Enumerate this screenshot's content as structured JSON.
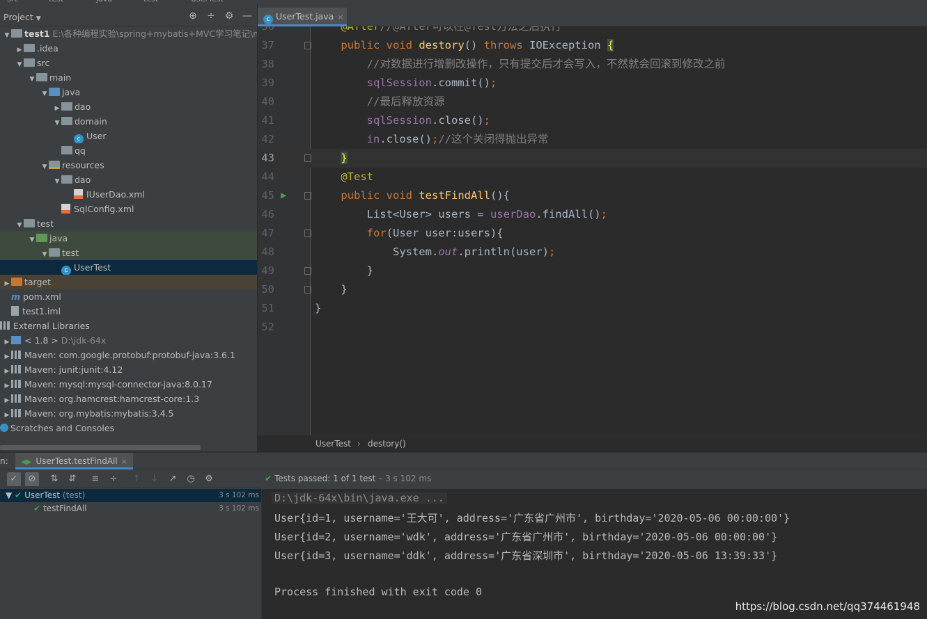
{
  "breadcrumb_top": [
    "src",
    "test",
    "java",
    "test",
    "UserTest"
  ],
  "project_panel": {
    "title": "Project",
    "tree": [
      {
        "label": "test1",
        "extra": "E:\\各种编程实验\\spring+mybatis+MVC学习笔记\\mybatis",
        "depth": 0,
        "arrow": "▼",
        "icon": "folder",
        "bold": true
      },
      {
        "label": ".idea",
        "depth": 1,
        "arrow": "▶",
        "icon": "folder"
      },
      {
        "label": "src",
        "depth": 1,
        "arrow": "▼",
        "icon": "folder"
      },
      {
        "label": "main",
        "depth": 2,
        "arrow": "▼",
        "icon": "folder"
      },
      {
        "label": "java",
        "depth": 3,
        "arrow": "▼",
        "icon": "folder-blue"
      },
      {
        "label": "dao",
        "depth": 4,
        "arrow": "▶",
        "icon": "folder"
      },
      {
        "label": "domain",
        "depth": 4,
        "arrow": "▼",
        "icon": "folder"
      },
      {
        "label": "User",
        "depth": 5,
        "arrow": "",
        "icon": "class"
      },
      {
        "label": "qq",
        "depth": 4,
        "arrow": "",
        "icon": "folder"
      },
      {
        "label": "resources",
        "depth": 3,
        "arrow": "▼",
        "icon": "folder-res"
      },
      {
        "label": "dao",
        "depth": 4,
        "arrow": "▼",
        "icon": "folder"
      },
      {
        "label": "IUserDao.xml",
        "depth": 5,
        "arrow": "",
        "icon": "xml"
      },
      {
        "label": "SqlConfig.xml",
        "depth": 4,
        "arrow": "",
        "icon": "xml"
      },
      {
        "label": "test",
        "depth": 1,
        "arrow": "▼",
        "icon": "folder"
      },
      {
        "label": "java",
        "depth": 2,
        "arrow": "▼",
        "icon": "folder-green",
        "highlight": "green"
      },
      {
        "label": "test",
        "depth": 3,
        "arrow": "▼",
        "icon": "folder",
        "highlight": "green"
      },
      {
        "label": "UserTest",
        "depth": 4,
        "arrow": "",
        "icon": "class",
        "highlight": "selected"
      },
      {
        "label": "target",
        "depth": 0,
        "arrow": "▶",
        "icon": "folder-orange",
        "highlight": "brown"
      },
      {
        "label": "pom.xml",
        "depth": 0,
        "arrow": "",
        "icon": "maven"
      },
      {
        "label": "test1.iml",
        "depth": 0,
        "arrow": "",
        "icon": "file"
      },
      {
        "label": "External Libraries",
        "depth": -1,
        "arrow": "",
        "icon": "lib"
      },
      {
        "label": "< 1.8 >",
        "extra": "D:\\jdk-64x",
        "depth": 0,
        "arrow": "▶",
        "icon": "jdk"
      },
      {
        "label": "Maven: com.google.protobuf:protobuf-java:3.6.1",
        "depth": 0,
        "arrow": "▶",
        "icon": "lib"
      },
      {
        "label": "Maven: junit:junit:4.12",
        "depth": 0,
        "arrow": "▶",
        "icon": "lib"
      },
      {
        "label": "Maven: mysql:mysql-connector-java:8.0.17",
        "depth": 0,
        "arrow": "▶",
        "icon": "lib"
      },
      {
        "label": "Maven: org.hamcrest:hamcrest-core:1.3",
        "depth": 0,
        "arrow": "▶",
        "icon": "lib"
      },
      {
        "label": "Maven: org.mybatis:mybatis:3.4.5",
        "depth": 0,
        "arrow": "▶",
        "icon": "lib"
      },
      {
        "label": "Scratches and Consoles",
        "depth": -1,
        "arrow": "",
        "icon": "scratch"
      }
    ]
  },
  "editor": {
    "tab_label": "UserTest.java",
    "breadcrumb": [
      "UserTest",
      "destory()"
    ],
    "current_line": 43,
    "lines": [
      {
        "n": 36,
        "tokens": [
          [
            "    ",
            ""
          ],
          [
            "@After",
            "ann"
          ],
          [
            "//@After可以在@Test方法之后执行",
            "cmt"
          ]
        ]
      },
      {
        "n": 37,
        "fold": true,
        "tokens": [
          [
            "    ",
            ""
          ],
          [
            "public ",
            "kw"
          ],
          [
            "void ",
            "kw"
          ],
          [
            "destory",
            "mname"
          ],
          [
            "() ",
            ""
          ],
          [
            "throws ",
            "kw"
          ],
          [
            "IOException ",
            ""
          ],
          [
            "{",
            "brace-hl"
          ]
        ]
      },
      {
        "n": 38,
        "tokens": [
          [
            "        ",
            ""
          ],
          [
            "//对数据进行增删改操作，只有提交后才会写入，不然就会回滚到修改之前",
            "cmt"
          ]
        ]
      },
      {
        "n": 39,
        "tokens": [
          [
            "        ",
            ""
          ],
          [
            "sqlSession",
            "field"
          ],
          [
            ".commit()",
            ""
          ],
          [
            ";",
            "kw"
          ]
        ]
      },
      {
        "n": 40,
        "tokens": [
          [
            "        ",
            ""
          ],
          [
            "//最后释放资源",
            "cmt"
          ]
        ]
      },
      {
        "n": 41,
        "tokens": [
          [
            "        ",
            ""
          ],
          [
            "sqlSession",
            "field"
          ],
          [
            ".close()",
            ""
          ],
          [
            ";",
            "kw"
          ]
        ]
      },
      {
        "n": 42,
        "tokens": [
          [
            "        ",
            ""
          ],
          [
            "in",
            "field"
          ],
          [
            ".close()",
            ""
          ],
          [
            ";",
            "kw"
          ],
          [
            "//这个关闭得抛出异常",
            "cmt"
          ]
        ]
      },
      {
        "n": 43,
        "fold": true,
        "tokens": [
          [
            "    ",
            ""
          ],
          [
            "}",
            "brace-hl"
          ]
        ]
      },
      {
        "n": 44,
        "tokens": [
          [
            "    ",
            ""
          ],
          [
            "@Test",
            "ann"
          ]
        ]
      },
      {
        "n": 45,
        "fold": true,
        "run": true,
        "tokens": [
          [
            "    ",
            ""
          ],
          [
            "public ",
            "kw"
          ],
          [
            "void ",
            "kw"
          ],
          [
            "testFindAll",
            "mname"
          ],
          [
            "(){",
            ""
          ]
        ]
      },
      {
        "n": 46,
        "tokens": [
          [
            "        ",
            ""
          ],
          [
            "List<User> users = ",
            ""
          ],
          [
            "userDao",
            "field"
          ],
          [
            ".findAll()",
            ""
          ],
          [
            ";",
            "kw"
          ]
        ]
      },
      {
        "n": 47,
        "fold": true,
        "tokens": [
          [
            "        ",
            ""
          ],
          [
            "for",
            "kw"
          ],
          [
            "(User user:users){",
            ""
          ]
        ]
      },
      {
        "n": 48,
        "tokens": [
          [
            "            ",
            ""
          ],
          [
            "System.",
            ""
          ],
          [
            "out",
            "static"
          ],
          [
            ".println(user)",
            ""
          ],
          [
            ";",
            "kw"
          ]
        ]
      },
      {
        "n": 49,
        "fold": true,
        "tokens": [
          [
            "        ",
            ""
          ],
          [
            "}",
            ""
          ]
        ]
      },
      {
        "n": 50,
        "fold": true,
        "tokens": [
          [
            "    ",
            ""
          ],
          [
            "}",
            ""
          ]
        ]
      },
      {
        "n": 51,
        "tokens": [
          [
            "}",
            ""
          ]
        ]
      },
      {
        "n": 52,
        "tokens": []
      }
    ]
  },
  "run_panel": {
    "label": "n:",
    "tab_label": "UserTest.testFindAll",
    "status_prefix": "Tests passed:",
    "status_value": "1",
    "status_suffix": "of 1 test",
    "status_time": "– 3 s 102 ms",
    "results": [
      {
        "label": "UserTest",
        "suffix": "(test)",
        "time": "3 s 102 ms",
        "depth": 0,
        "selected": true
      },
      {
        "label": "testFindAll",
        "suffix": "",
        "time": "3 s 102 ms",
        "depth": 1,
        "selected": false
      }
    ],
    "console": [
      "D:\\jdk-64x\\bin\\java.exe ...",
      "User{id=1, username='王大可', address='广东省广州市', birthday='2020-05-06 00:00:00'}",
      "User{id=2, username='wdk', address='广东省广州市', birthday='2020-05-06 00:00:00'}",
      "User{id=3, username='ddk', address='广东省深圳市', birthday='2020-05-06 13:39:33'}",
      "",
      "Process finished with exit code 0"
    ],
    "watermark": "https://blog.csdn.net/qq374461948"
  }
}
